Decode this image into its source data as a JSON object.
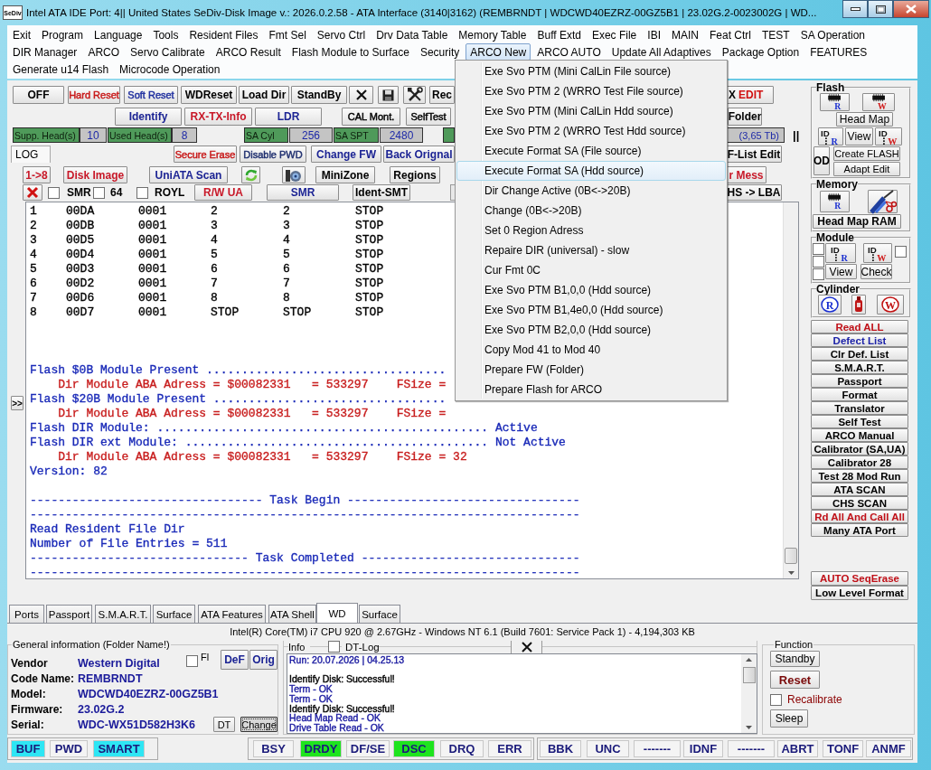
{
  "window": {
    "logo": "SeDiv",
    "title": "Intel ATA IDE  Port: 4|| United States  SeDiv-Disk Image v.: 2026.0.2.58 - ATA Interface (3140|3162)  (REMBRNDT | WDCWD40EZRZ-00GZ5B1 | 23.02G.2-0023002G | WD..."
  },
  "menu_bar": {
    "rows": [
      {
        "items": [
          {
            "label": "Exit",
            "selected": false
          },
          {
            "label": "Program",
            "selected": false
          },
          {
            "label": "Language",
            "selected": false
          },
          {
            "label": "Tools",
            "selected": false
          },
          {
            "label": "Resident Files",
            "selected": false
          },
          {
            "label": "Fmt Sel",
            "selected": false
          },
          {
            "label": "Servo Ctrl",
            "selected": false
          },
          {
            "label": "Drv Data Table",
            "selected": false
          },
          {
            "label": "Memory Table",
            "selected": false
          },
          {
            "label": "Buff Extd",
            "selected": false
          },
          {
            "label": "Exec File",
            "selected": false
          },
          {
            "label": "IBI",
            "selected": false
          },
          {
            "label": "MAIN",
            "selected": false
          },
          {
            "label": "Feat Ctrl",
            "selected": false
          },
          {
            "label": "TEST",
            "selected": false
          },
          {
            "label": "SA Operation",
            "selected": false
          }
        ]
      },
      {
        "items": [
          {
            "label": "DIR Manager",
            "selected": false
          },
          {
            "label": "ARCO",
            "selected": false
          },
          {
            "label": "Servo Calibrate",
            "selected": false
          },
          {
            "label": "ARCO Result",
            "selected": false
          },
          {
            "label": "Flash Module to Surface",
            "selected": false
          },
          {
            "label": "Security",
            "selected": false
          },
          {
            "label": "ARCO New",
            "selected": true
          },
          {
            "label": "ARCO AUTO",
            "selected": false
          },
          {
            "label": "Update All Adaptives",
            "selected": false
          },
          {
            "label": "Package Option",
            "selected": false
          },
          {
            "label": "FEATURES",
            "selected": false
          }
        ]
      },
      {
        "items": [
          {
            "label": "Generate u14 Flash",
            "selected": false
          },
          {
            "label": "Microcode Operation",
            "selected": false
          }
        ]
      }
    ]
  },
  "dropdown": {
    "items": [
      {
        "label": "Exe Svo PTM (Mini CalLin File source)",
        "selected": false
      },
      {
        "label": "Exe Svo PTM 2 (WRRO Test File source)",
        "selected": false
      },
      {
        "label": "Exe Svo PTM (Mini CalLin Hdd source)",
        "selected": false
      },
      {
        "label": "Exe Svo PTM 2 (WRRO Test Hdd source)",
        "selected": false
      },
      {
        "label": "Execute Format SA (File source)",
        "selected": false
      },
      {
        "label": "Execute Format SA (Hdd source)",
        "selected": true
      },
      {
        "label": "Dir Change Active (0B<->20B)",
        "selected": false
      },
      {
        "label": "Change (0B<->20B)",
        "selected": false
      },
      {
        "label": "Set 0 Region Adress",
        "selected": false
      },
      {
        "label": "Repaire DIR (universal) - slow",
        "selected": false
      },
      {
        "label": "Cur Fmt 0C",
        "selected": false
      },
      {
        "label": "Exe Svo PTM B1,0,0 (Hdd source)",
        "selected": false
      },
      {
        "label": "Exe Svo PTM B1,4e0,0 (Hdd source)",
        "selected": false
      },
      {
        "label": "Exe Svo PTM B2,0,0 (Hdd source)",
        "selected": false
      },
      {
        "label": "Copy Mod 41 to Mod 40",
        "selected": false
      },
      {
        "label": "Prepare FW (Folder)",
        "selected": false
      },
      {
        "label": "Prepare Flash for ARCO",
        "selected": false
      }
    ]
  },
  "toolbar": {
    "row1": {
      "buttons": [
        {
          "label": "OFF",
          "kind": "strong",
          "color": "#000000"
        },
        {
          "label": "Hard Reset",
          "kind": "text",
          "color": "#c81818"
        },
        {
          "label": "Soft Reset",
          "kind": "text",
          "color": "#1f2f9f"
        },
        {
          "label": "WDReset",
          "kind": "strong",
          "color": "#000000"
        },
        {
          "label": "Load Dir",
          "kind": "strong",
          "color": "#000000"
        },
        {
          "label": "StandBy",
          "kind": "strong",
          "color": "#000000"
        }
      ],
      "tail": {
        "label": "Rec",
        "kind": "strong",
        "color": "#000000"
      }
    },
    "row2": {
      "buttons": [
        {
          "label": "Identify",
          "kind": "strong",
          "color": "#1c2494"
        },
        {
          "label": "RX-TX-Info",
          "kind": "strong",
          "color": "#c81828"
        },
        {
          "label": "LDR",
          "kind": "strong",
          "color": "#1c2494"
        },
        {
          "label": "CAL Mont.",
          "kind": "text",
          "color": "#000000"
        },
        {
          "label": "SelfTest",
          "kind": "text",
          "color": "#000000"
        }
      ]
    },
    "row3": {
      "fields": [
        {
          "label": "Supp. Head(s)",
          "value": "10"
        },
        {
          "label": "Used Head(s)",
          "value": "8"
        },
        {
          "label": "SA Cyl",
          "value": "256"
        },
        {
          "label": "SA SPT",
          "value": "2480"
        }
      ]
    },
    "row4": {
      "tab": {
        "label": "LOG",
        "selected": true
      },
      "buttons": [
        {
          "label": "Secure Erase",
          "kind": "text",
          "color": "#c81818"
        },
        {
          "label": "Disable PWD",
          "kind": "text",
          "color": "#1f2f6f"
        },
        {
          "label": "Change FW",
          "kind": "strong",
          "color": "#1c2494"
        },
        {
          "label": "Back Orignal",
          "kind": "strong",
          "color": "#1c2494"
        }
      ]
    },
    "row5": {
      "buttons_before": [
        {
          "label": "1->8",
          "kind": "strong",
          "color": "#c81828"
        },
        {
          "label": "Disk Image",
          "kind": "strong",
          "color": "#c81828"
        },
        {
          "label": "UniATA Scan",
          "kind": "strong",
          "color": "#1c2494"
        }
      ],
      "buttons_after": [
        {
          "label": "MiniZone",
          "kind": "strong",
          "color": "#000000"
        },
        {
          "label": "Regions",
          "kind": "strong",
          "color": "#000000"
        }
      ]
    },
    "row6": {
      "checks": [
        {
          "label": "SMR",
          "checked": false
        },
        {
          "label": "64",
          "checked": false
        },
        {
          "label": "ROYL",
          "checked": false
        }
      ],
      "buttons": [
        {
          "label": "R/W UA",
          "kind": "strong",
          "color": "#c81828"
        },
        {
          "label": "SMR",
          "kind": "strong",
          "color": "#1c2494"
        },
        {
          "label": "Ident-SMT",
          "kind": "strong",
          "color": "#000000"
        }
      ]
    },
    "right": {
      "edit_parts": [
        {
          "text": "X",
          "color": "#000000"
        },
        {
          "text": "EDIT",
          "color": "#d01010"
        }
      ],
      "folder": {
        "label": "Folder",
        "kind": "strong",
        "color": "#000000"
      },
      "capacity": "(3,65 Tb)",
      "pause_mark": "||",
      "flist": {
        "label": "F-List Edit",
        "kind": "strong",
        "color": "#000000"
      },
      "mess": {
        "label": "r Mess",
        "kind": "strong",
        "color": "#c81828"
      },
      "lba": {
        "label": "HS -> LBA",
        "kind": "strong",
        "color": "#000000"
      }
    }
  },
  "log": {
    "expand_button": ">>",
    "rows": [
      [
        "1",
        "00DA",
        "0001",
        "2",
        "2",
        "STOP"
      ],
      [
        "2",
        "00DB",
        "0001",
        "3",
        "3",
        "STOP"
      ],
      [
        "3",
        "00D5",
        "0001",
        "4",
        "4",
        "STOP"
      ],
      [
        "4",
        "00D4",
        "0001",
        "5",
        "5",
        "STOP"
      ],
      [
        "5",
        "00D3",
        "0001",
        "6",
        "6",
        "STOP"
      ],
      [
        "6",
        "00D2",
        "0001",
        "7",
        "7",
        "STOP"
      ],
      [
        "7",
        "00D6",
        "0001",
        "8",
        "8",
        "STOP"
      ],
      [
        "8",
        "00D7",
        "0001",
        "STOP",
        "STOP",
        "STOP"
      ]
    ],
    "blocks": [
      [
        {
          "text": "Flash $0B Module Present ..................................",
          "color": "#1a2ab8"
        },
        {
          "text": "    Dir Module ABA Adress = $00082331   = 533297    FSize =",
          "color": "#c81e1e"
        },
        {
          "text": "Flash $20B Module Present .................................",
          "color": "#1a2ab8"
        },
        {
          "text": "    Dir Module ABA Adress = $00082331   = 533297    FSize =",
          "color": "#c81e1e"
        },
        {
          "text": "Flash DIR Module: ............................................... Active",
          "color": "#1a2ab8"
        },
        {
          "text": "Flash DIR ext Module: ........................................... Not Active",
          "color": "#1a2ab8"
        },
        {
          "text": "    Dir Module ABA Adress = $00082331   = 533297    FSize = 32",
          "color": "#c81e1e"
        },
        {
          "text": "Version: 82",
          "color": "#1a2ab8"
        }
      ],
      [
        {
          "text": "--------------------------------- Task Begin ---------------------------------",
          "color": "#1a2ab8"
        },
        {
          "text": "------------------------------------------------------------------------------",
          "color": "#1a2ab8"
        },
        {
          "text": "Read Resident File Dir",
          "color": "#1a2ab8"
        },
        {
          "text": "Number of File Entries = 511",
          "color": "#1a2ab8"
        },
        {
          "text": "------------------------------- Task Completed -------------------------------",
          "color": "#1a2ab8"
        },
        {
          "text": "------------------------------------------------------------------------------",
          "color": "#1a2ab8"
        }
      ]
    ]
  },
  "side_panel": {
    "flash": {
      "title": "Flash",
      "chips": [
        {
          "letter": "R",
          "color": "#1a2fd0"
        },
        {
          "letter": "W",
          "color": "#d01a1a"
        }
      ],
      "head_map": "Head Map",
      "id_icons": [
        {
          "prefix": "ID",
          "letter": "R",
          "color": "#1a2fd0"
        },
        {
          "prefix": "ID",
          "letter": "W",
          "color": "#d01a1a"
        }
      ],
      "view": "View",
      "od": "OD",
      "create": "Create FLASH",
      "adapt": "Adapt Edit"
    },
    "memory": {
      "title": "Memory",
      "chip": {
        "letter": "R",
        "color": "#1a2fd0"
      },
      "head_map_ram": "Head Map RAM"
    },
    "module": {
      "title": "Module",
      "checks": [
        {
          "checked": false
        },
        {
          "checked": false
        },
        {
          "checked": false
        },
        {
          "checked": false
        }
      ],
      "id_icons": [
        {
          "prefix": "ID",
          "letter": "R",
          "color": "#1a2fd0"
        },
        {
          "prefix": "ID",
          "letter": "W",
          "color": "#d01a1a"
        }
      ],
      "view": "View",
      "check": "Check"
    },
    "cylinder": {
      "title": "Cylinder",
      "icons": [
        {
          "letter": "R",
          "color": "#1a2fd0"
        },
        {
          "letter": "W",
          "color": "#c01010"
        }
      ]
    },
    "buttons": [
      {
        "label": "Read ALL",
        "color": "#c01018"
      },
      {
        "label": "Defect List",
        "color": "#1c22a8"
      },
      {
        "label": "Clr Def. List",
        "color": "#000000"
      },
      {
        "label": "S.M.A.R.T.",
        "color": "#000000"
      },
      {
        "label": "Passport",
        "color": "#000000"
      },
      {
        "label": "Format",
        "color": "#000000"
      },
      {
        "label": "Translator",
        "color": "#000000"
      },
      {
        "label": "Self Test",
        "color": "#000000"
      },
      {
        "label": "ARCO Manual",
        "color": "#000000"
      },
      {
        "label": "Calibrator (SA,UA)",
        "color": "#000000"
      },
      {
        "label": "Calibrator 28",
        "color": "#000000"
      },
      {
        "label": "Test 28 Mod Run",
        "color": "#000000"
      },
      {
        "label": "ATA SCAN",
        "color": "#000000"
      },
      {
        "label": "CHS SCAN",
        "color": "#000000"
      },
      {
        "label": "Rd All And Call All",
        "color": "#c01018"
      },
      {
        "label": "Many ATA Port",
        "color": "#000000"
      }
    ],
    "bottom_buttons": [
      {
        "label": "AUTO SeqErase",
        "color": "#c01018"
      },
      {
        "label": "Low Level Format",
        "color": "#000000"
      }
    ]
  },
  "bottom_tabs": [
    {
      "label": "Ports",
      "selected": false
    },
    {
      "label": "Passport",
      "selected": false
    },
    {
      "label": "S.M.A.R.T.",
      "selected": false
    },
    {
      "label": "Surface",
      "selected": false
    },
    {
      "label": "ATA Features",
      "selected": false
    },
    {
      "label": "ATA Shell",
      "selected": false
    },
    {
      "label": "WD",
      "selected": true
    },
    {
      "label": "Surface",
      "selected": false
    }
  ],
  "system_info": "Intel(R) Core(TM) i7 CPU 920  @ 2.67GHz - Windows NT 6.1 (Build 7601: Service Pack 1) -  4,194,303 KB",
  "general_info": {
    "title": "General information (Folder Name!)",
    "fl_check": {
      "label": "Fl",
      "checked": false
    },
    "buttons": [
      "DeF",
      "Orig"
    ],
    "fields": [
      {
        "label": "Vendor",
        "value": "Western Digital"
      },
      {
        "label": "Code Name:",
        "value": "REMBRNDT"
      },
      {
        "label": "Model:",
        "value": "WDCWD40EZRZ-00GZ5B1"
      },
      {
        "label": "Firmware:",
        "value": "23.02G.2"
      },
      {
        "label": "Serial:",
        "value": "WDC-WX51D582H3K6"
      }
    ],
    "dt_button": "DT",
    "change_button": "Change"
  },
  "info": {
    "title": "Info",
    "dt_log": {
      "label": "DT-Log",
      "checked": false
    },
    "lines": [
      {
        "text": "Run: 20.07.2026 | 04.25.13",
        "color": "#1a1aa0"
      },
      {
        "text": "Identify Disk: Successful!",
        "color": "#000000"
      },
      {
        "text": "Term - OK",
        "color": "#1a1aa0"
      },
      {
        "text": "Term - OK",
        "color": "#1a1aa0"
      },
      {
        "text": "Identify Disk: Successful!",
        "color": "#000000"
      },
      {
        "text": "Head Map Read - OK",
        "color": "#1a1aa0"
      },
      {
        "text": "Drive Table Read - OK",
        "color": "#1a1aa0"
      }
    ]
  },
  "function": {
    "title": "Function",
    "standby": "Standby",
    "reset": "Reset",
    "recalibrate": {
      "label": "Recalibrate",
      "checked": false
    },
    "sleep": "Sleep"
  },
  "status_bar": {
    "groups": [
      [
        {
          "label": "BUF",
          "on": true
        },
        {
          "label": "PWD",
          "on": false
        },
        {
          "label": "SMART",
          "on": true
        }
      ],
      [
        {
          "label": "BSY",
          "on": false
        },
        {
          "label": "DRDY",
          "on": true
        },
        {
          "label": "DF/SE",
          "on": false
        },
        {
          "label": "DSC",
          "on": true
        },
        {
          "label": "DRQ",
          "on": false
        },
        {
          "label": "ERR",
          "on": false
        }
      ],
      [
        {
          "label": "BBK",
          "on": false
        },
        {
          "label": "UNC",
          "on": false
        },
        {
          "label": "-------",
          "on": false
        },
        {
          "label": "IDNF",
          "on": false
        },
        {
          "label": "-------",
          "on": false
        },
        {
          "label": "ABRT",
          "on": false
        },
        {
          "label": "TONF",
          "on": false
        },
        {
          "label": "ANMF",
          "on": false
        }
      ]
    ]
  }
}
